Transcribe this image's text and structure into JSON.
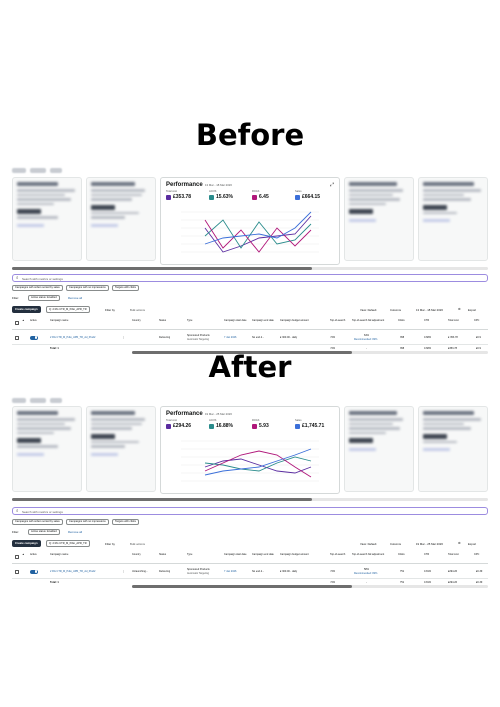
{
  "headings": {
    "before": "Before",
    "after": "After"
  },
  "before": {
    "performance": {
      "title": "Performance",
      "date_range": "13 Mar - 18 Mar 2026",
      "metrics": [
        {
          "label": "Total cost",
          "value": "£353.78",
          "color": "#5a2ca0"
        },
        {
          "label": "ACOS",
          "value": "15.63%",
          "color": "#2a8c8c"
        },
        {
          "label": "ROAS",
          "value": "6.45",
          "color": "#b0177a"
        },
        {
          "label": "Sales",
          "value": "£664.15",
          "color": "#3b6fd9"
        }
      ]
    },
    "search": {
      "placeholder": "Search with metrics or settings"
    },
    "chips": [
      "Campaigns with orders sorted by sales",
      "Campaigns with no impressions",
      "Targets with clicks"
    ],
    "filter": {
      "label": "Filter:",
      "active_status": "Active status: Enabled",
      "remove_all": "Remove all"
    },
    "toolbar": {
      "create": "Create campaign",
      "campaign_select": "Q: 2 RG CTR_M_Pdto_APR_TR",
      "filter_by": "Filter by",
      "bulk_actions": "Bulk actions",
      "view": "View: Default",
      "columns": "Columns",
      "date": "13 Mar - 18 Mar 2026",
      "export": "Export"
    },
    "columns": [
      "Active",
      "Campaign name",
      "Country",
      "Status",
      "Type",
      "Campaign start date",
      "Campaign end date",
      "Campaign budget amount",
      "Top-of-search",
      "Top-of-search bid adjustment",
      "Clicks",
      "CTR",
      "Total cost",
      "CPC"
    ],
    "rows": [
      {
        "name": "2 RG CTR_M_Pdto_APR_TR_Ad_Prod2",
        "country": "",
        "status": "Delivering",
        "type": "Sponsored Products",
        "type_sub": "Automatic Targeting",
        "start": "7 Jan 2026",
        "end": "No end d...",
        "budget": "£ 300.00 - daily",
        "tos": "<5%",
        "tos_bid": "64%",
        "tos_bid_sub": "Recommended: 82%",
        "clicks": "358",
        "ctr": "0.68%",
        "cost": "£ 353.78",
        "cpc": "£0.9"
      }
    ],
    "total": {
      "label": "Total: 1",
      "tos": "<5%",
      "tos_bid": "-",
      "clicks": "358",
      "ctr": "0.68%",
      "cost": "£353.78",
      "cpc": "£0.9"
    }
  },
  "after": {
    "performance": {
      "title": "Performance",
      "date_range": "19 Mar - 25 Mar 2026",
      "metrics": [
        {
          "label": "Total cost",
          "value": "£294.26",
          "color": "#5a2ca0"
        },
        {
          "label": "ACOS",
          "value": "16.88%",
          "color": "#2a8c8c"
        },
        {
          "label": "ROAS",
          "value": "5.93",
          "color": "#b0177a"
        },
        {
          "label": "Sales",
          "value": "£1,745.71",
          "color": "#3b6fd9"
        }
      ]
    },
    "search": {
      "placeholder": "Search with metrics or settings"
    },
    "chips": [
      "Campaigns with orders sorted by sales",
      "Campaigns with no impressions",
      "Targets with clicks"
    ],
    "filter": {
      "label": "Filter:",
      "active_status": "Active status: Enabled",
      "remove_all": "Remove all"
    },
    "toolbar": {
      "create": "Create campaign",
      "campaign_select": "Q: 2 RG CTR_M_Pdto_APR_TR",
      "filter_by": "Filter by",
      "bulk_actions": "Bulk actions",
      "view": "View: Default",
      "columns": "Columns",
      "date": "19 Mar - 25 Mar 2026",
      "export": "Export"
    },
    "columns": [
      "Active",
      "Campaign name",
      "Country",
      "Status",
      "Type",
      "Campaign start date",
      "Campaign end date",
      "Campaign budget amount",
      "Top-of-search",
      "Top-of-search bid adjustment",
      "Clicks",
      "CTR",
      "Total cost",
      "CPC"
    ],
    "rows": [
      {
        "name": "2 RG CTR_M_Pdto_APR_TR_Ad_Prod2",
        "country": "Unlaunching...",
        "status": "Delivering",
        "type": "Sponsored Products",
        "type_sub": "Automatic Targeting",
        "start": "7 Jan 2026",
        "end": "No end d...",
        "budget": "£ 300.00 - daily",
        "tos": "<5%",
        "tos_bid": "58%",
        "tos_bid_sub": "Recommended: 82%",
        "clicks": "751",
        "ctr": "0.81%",
        "cost": "£294.26",
        "cpc": "£0.39"
      }
    ],
    "total": {
      "label": "Total: 1",
      "tos": "<5%",
      "tos_bid": "-",
      "clicks": "751",
      "ctr": "0.81%",
      "cost": "£294.26",
      "cpc": "£0.39"
    }
  }
}
